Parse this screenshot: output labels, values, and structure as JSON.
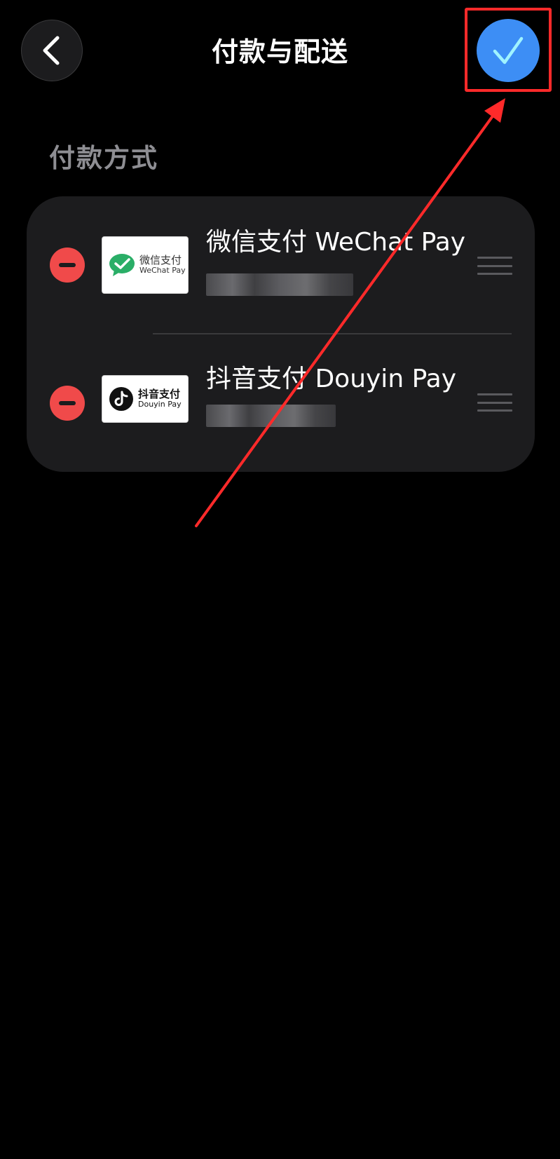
{
  "header": {
    "title": "付款与配送",
    "back_icon": "chevron-left-icon",
    "done_icon": "checkmark-icon"
  },
  "section": {
    "title": "付款方式"
  },
  "payment_methods": [
    {
      "name": "微信支付 WeChat Pay",
      "logo_text_cn": "微信支付",
      "logo_text_en": "WeChat Pay",
      "logo_icon": "wechat-icon",
      "detail": "",
      "detail_redacted": true
    },
    {
      "name": "抖音支付 Douyin Pay",
      "logo_text_cn": "抖音支付",
      "logo_text_en": "Douyin Pay",
      "logo_icon": "douyin-icon",
      "detail": "",
      "detail_redacted": true
    }
  ],
  "colors": {
    "background": "#000000",
    "card": "#1c1c1e",
    "accent": "#3d8ef5",
    "delete": "#f04a4a",
    "annotation": "#ff2a2a",
    "wechat_green": "#2aae67"
  }
}
